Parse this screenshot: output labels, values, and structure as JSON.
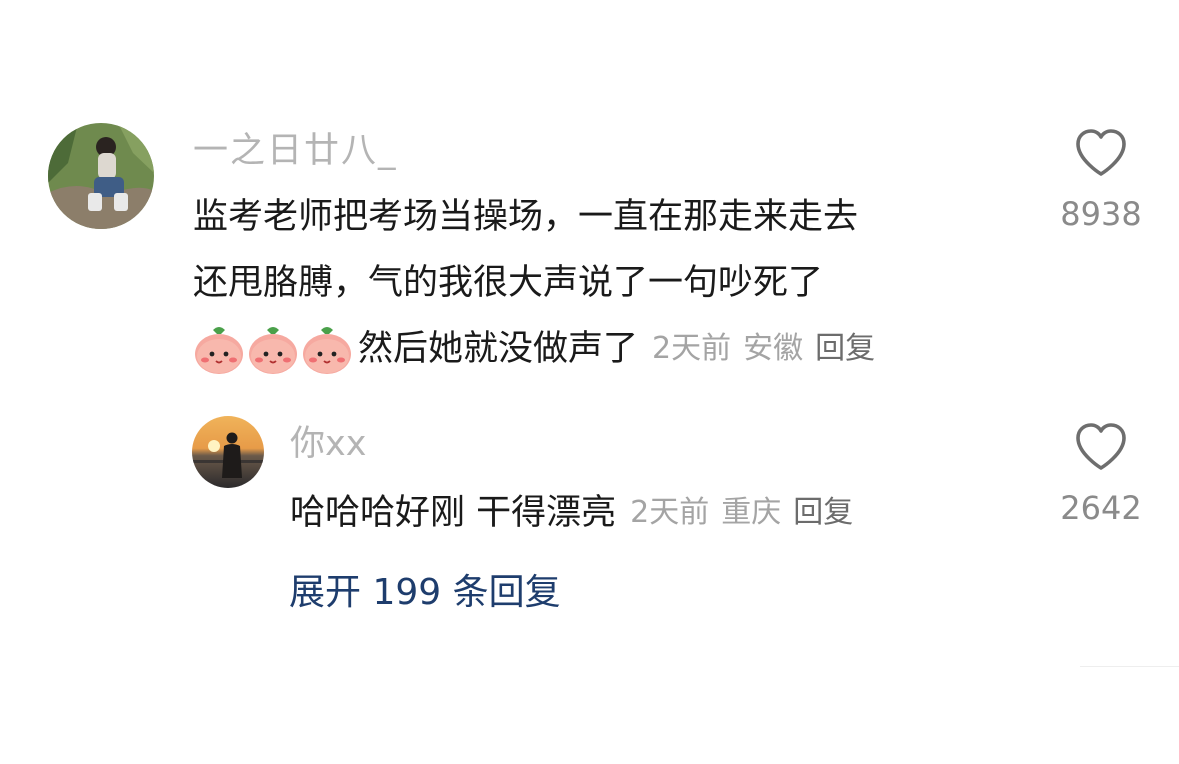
{
  "comment": {
    "username": "一之日廿八_",
    "text_line_1": "监考老师把考场当操场，一直在那走来走去",
    "text_line_2": "还甩胳膊，气的我很大声说了一句吵死了",
    "text_line_3": "然后她就没做声了",
    "time": "2天前",
    "location": "安徽",
    "reply_label": "回复",
    "like_count": "8938",
    "icons": [
      "heart-outline-icon",
      "peach-face-emoji"
    ]
  },
  "reply": {
    "username": "你xx",
    "text": "哈哈哈好刚 干得漂亮",
    "time": "2天前",
    "location": "重庆",
    "reply_label": "回复",
    "like_count": "2642"
  },
  "expand_label": "展开 199 条回复",
  "colors": {
    "username": "#b4b4b4",
    "body_text": "#1a1a1a",
    "meta": "#a4a4a4",
    "expand_link": "#1e3d6d",
    "like_count": "#8a8a8a"
  }
}
